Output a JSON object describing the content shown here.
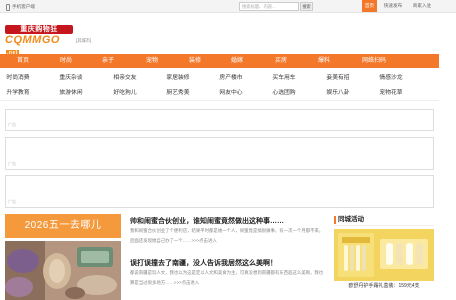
{
  "topbar": {
    "mobile_label": "手机客户端",
    "search_placeholder": "搜索标题、内容...",
    "search_button": "搜索",
    "home_link": "首页",
    "post_link": "快速发布",
    "biz_link": "商家入驻"
  },
  "header": {
    "logo_line1": "重庆购物狂",
    "logo_line2": "CQMMGO",
    "logo_net": ".net",
    "city": "[其城市]"
  },
  "nav": {
    "items": [
      "首页",
      "时尚",
      "亲子",
      "宠物",
      "装修",
      "婚嫁",
      "买房",
      "爆料",
      "网络扫码"
    ]
  },
  "sublinks": {
    "row1": [
      "时尚消费",
      "重庆杂谈",
      "相亲交友",
      "家居装修",
      "房产楼市",
      "买车用车",
      "妾美有招",
      "情感沙龙"
    ],
    "row2": [
      "升学教育",
      "旅游休闲",
      "好吃狗儿",
      "厨艺秀美",
      "网友中心",
      "心选团购",
      "娱乐八卦",
      "宠物花草"
    ]
  },
  "ads": {
    "label": "广告"
  },
  "feature": {
    "banner": "2026五一去哪儿"
  },
  "articles": [
    {
      "title": "帅和闹蜜合伙创业，谁知闹蜜竟然做出这种事……",
      "text": "我和闹蜜合伙创业了个便利店，结果平时都是她一个人，闹蜜竟是搞很做事，有一次一个月都不来，后面还发现她自己办了一个……>>>点击进入"
    },
    {
      "title": "误打误撞去了南疆，没人告诉我居然这么美啊！",
      "text": "都说南疆是玩人文，我也以为这是定以人文和美食为主，可真没想到南疆都有东西超这么美啊，我也算是当过很多地方……>>>点击进入"
    }
  ],
  "side": {
    "title": "同城活动",
    "caption": "欧舒丹护手霜礼盒装：159元4支"
  }
}
